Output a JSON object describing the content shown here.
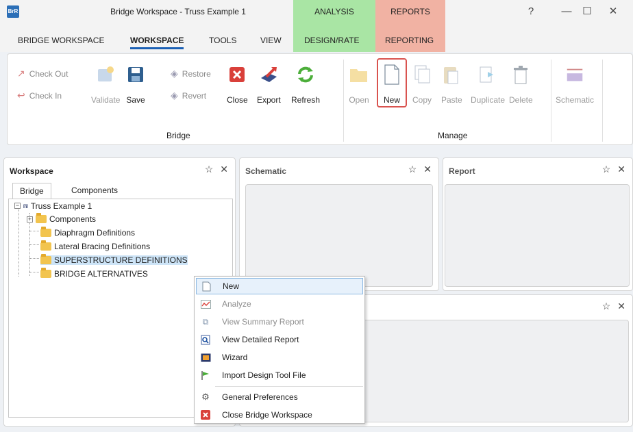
{
  "window": {
    "title": "Bridge Workspace - Truss Example 1",
    "logo": "BrR",
    "help": "?",
    "minimize": "—",
    "maximize": "☐",
    "close": "✕"
  },
  "context_tabs": {
    "analysis": "ANALYSIS",
    "reports": "REPORTS",
    "analysis_color": "#a9e5a4",
    "reports_color": "#f1b2a3"
  },
  "menu": {
    "tabs": [
      {
        "label": "BRIDGE WORKSPACE"
      },
      {
        "label": "WORKSPACE",
        "active": true
      },
      {
        "label": "TOOLS"
      },
      {
        "label": "VIEW"
      },
      {
        "label": "DESIGN/RATE"
      },
      {
        "label": "REPORTING"
      }
    ]
  },
  "ribbon": {
    "check_out": "Check Out",
    "check_in": "Check In",
    "validate": "Validate",
    "save": "Save",
    "restore": "Restore",
    "revert": "Revert",
    "close": "Close",
    "export": "Export",
    "refresh": "Refresh",
    "open": "Open",
    "new": "New",
    "copy": "Copy",
    "paste": "Paste",
    "duplicate": "Duplicate",
    "delete": "Delete",
    "schematic": "Schematic",
    "group_bridge": "Bridge",
    "group_manage": "Manage"
  },
  "workspace": {
    "title": "Workspace",
    "tabs": [
      "Bridge",
      "Components"
    ],
    "tree": {
      "root": "Truss Example 1",
      "items": [
        "Components",
        "Diaphragm Definitions",
        "Lateral Bracing Definitions",
        "SUPERSTRUCTURE DEFINITIONS",
        "BRIDGE ALTERNATIVES"
      ]
    }
  },
  "panels": {
    "schematic_title": "Schematic",
    "report_title": "Report"
  },
  "context_menu": {
    "items": [
      {
        "label": "New",
        "icon": "new-doc-icon"
      },
      {
        "label": "Analyze",
        "icon": "analyze-icon"
      },
      {
        "label": "View Summary Report",
        "icon": "summary-report-icon"
      },
      {
        "label": "View Detailed Report",
        "icon": "detailed-report-icon"
      },
      {
        "label": "Wizard",
        "icon": "wizard-icon"
      },
      {
        "label": "Import Design Tool File",
        "icon": "flag-icon"
      },
      {
        "label": "General Preferences",
        "icon": "gear-icon"
      },
      {
        "label": "Close Bridge Workspace",
        "icon": "close-red-icon"
      }
    ]
  }
}
